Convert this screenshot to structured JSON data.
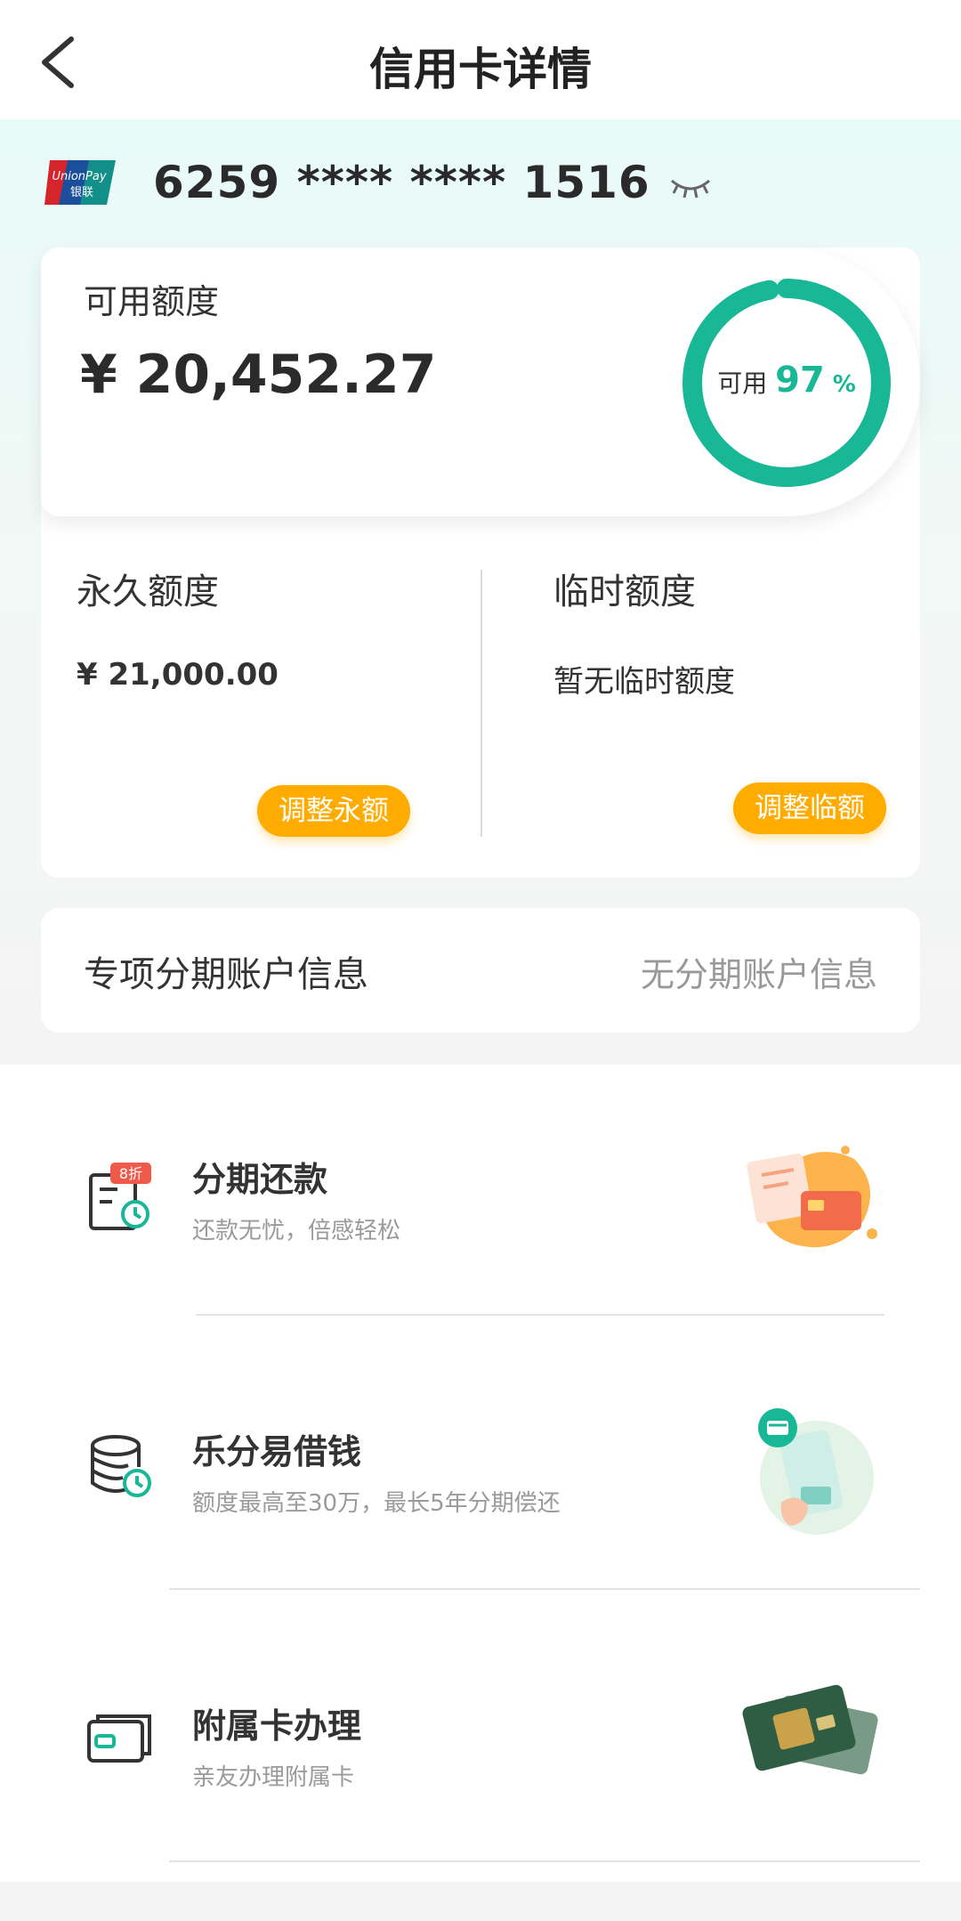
{
  "header": {
    "title": "信用卡详情",
    "back_icon": "chevron-left-icon"
  },
  "card": {
    "number": "6259 **** **** 1516",
    "brand_logo": "unionpay-logo",
    "brand_text": "UnionPay 银联",
    "eye_icon": "eye-closed-icon"
  },
  "available": {
    "label": "可用额度",
    "amount": "¥ 20,452.27",
    "ring_label": "可用",
    "ring_percent": "97",
    "ring_unit": "%",
    "ring_fraction": 0.97,
    "ring_color": "#18b796"
  },
  "permanent": {
    "title": "永久额度",
    "value": "¥ 21,000.00",
    "button": "调整永额"
  },
  "temporary": {
    "title": "临时额度",
    "value": "暂无临时额度",
    "button": "调整临额"
  },
  "installment_account": {
    "label": "专项分期账户信息",
    "value": "无分期账户信息"
  },
  "services": [
    {
      "title": "分期还款",
      "subtitle": "还款无忧，倍感轻松",
      "icon": "installment-doc-icon",
      "badge": "8折"
    },
    {
      "title": "乐分易借钱",
      "subtitle": "额度最高至30万，最长5年分期偿还",
      "icon": "coin-stack-icon"
    },
    {
      "title": "附属卡办理",
      "subtitle": "亲友办理附属卡",
      "icon": "card-icon"
    }
  ],
  "colors": {
    "accent": "#18b796",
    "button": "#ffab00"
  }
}
